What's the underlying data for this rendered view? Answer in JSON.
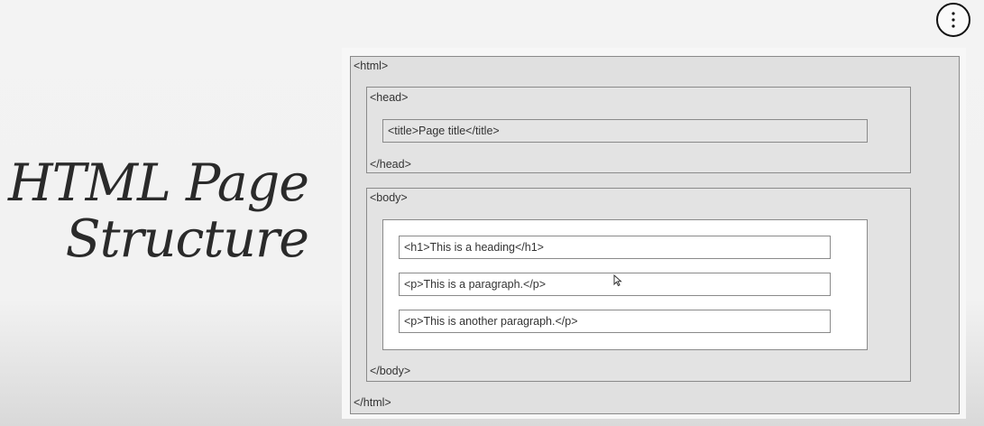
{
  "slide": {
    "title_line1": "HTML Page",
    "title_line2": "Structure"
  },
  "menu": {
    "icon": "vertical-ellipsis-icon"
  },
  "diagram": {
    "html_open": "<html>",
    "html_close": "</html>",
    "head_open": "<head>",
    "head_close": "</head>",
    "title": "<title>Page title</title>",
    "body_open": "<body>",
    "body_close": "</body>",
    "h1": "<h1>This is a heading</h1>",
    "p1": "<p>This is a paragraph.</p>",
    "p2": "<p>This is another paragraph.</p>"
  }
}
